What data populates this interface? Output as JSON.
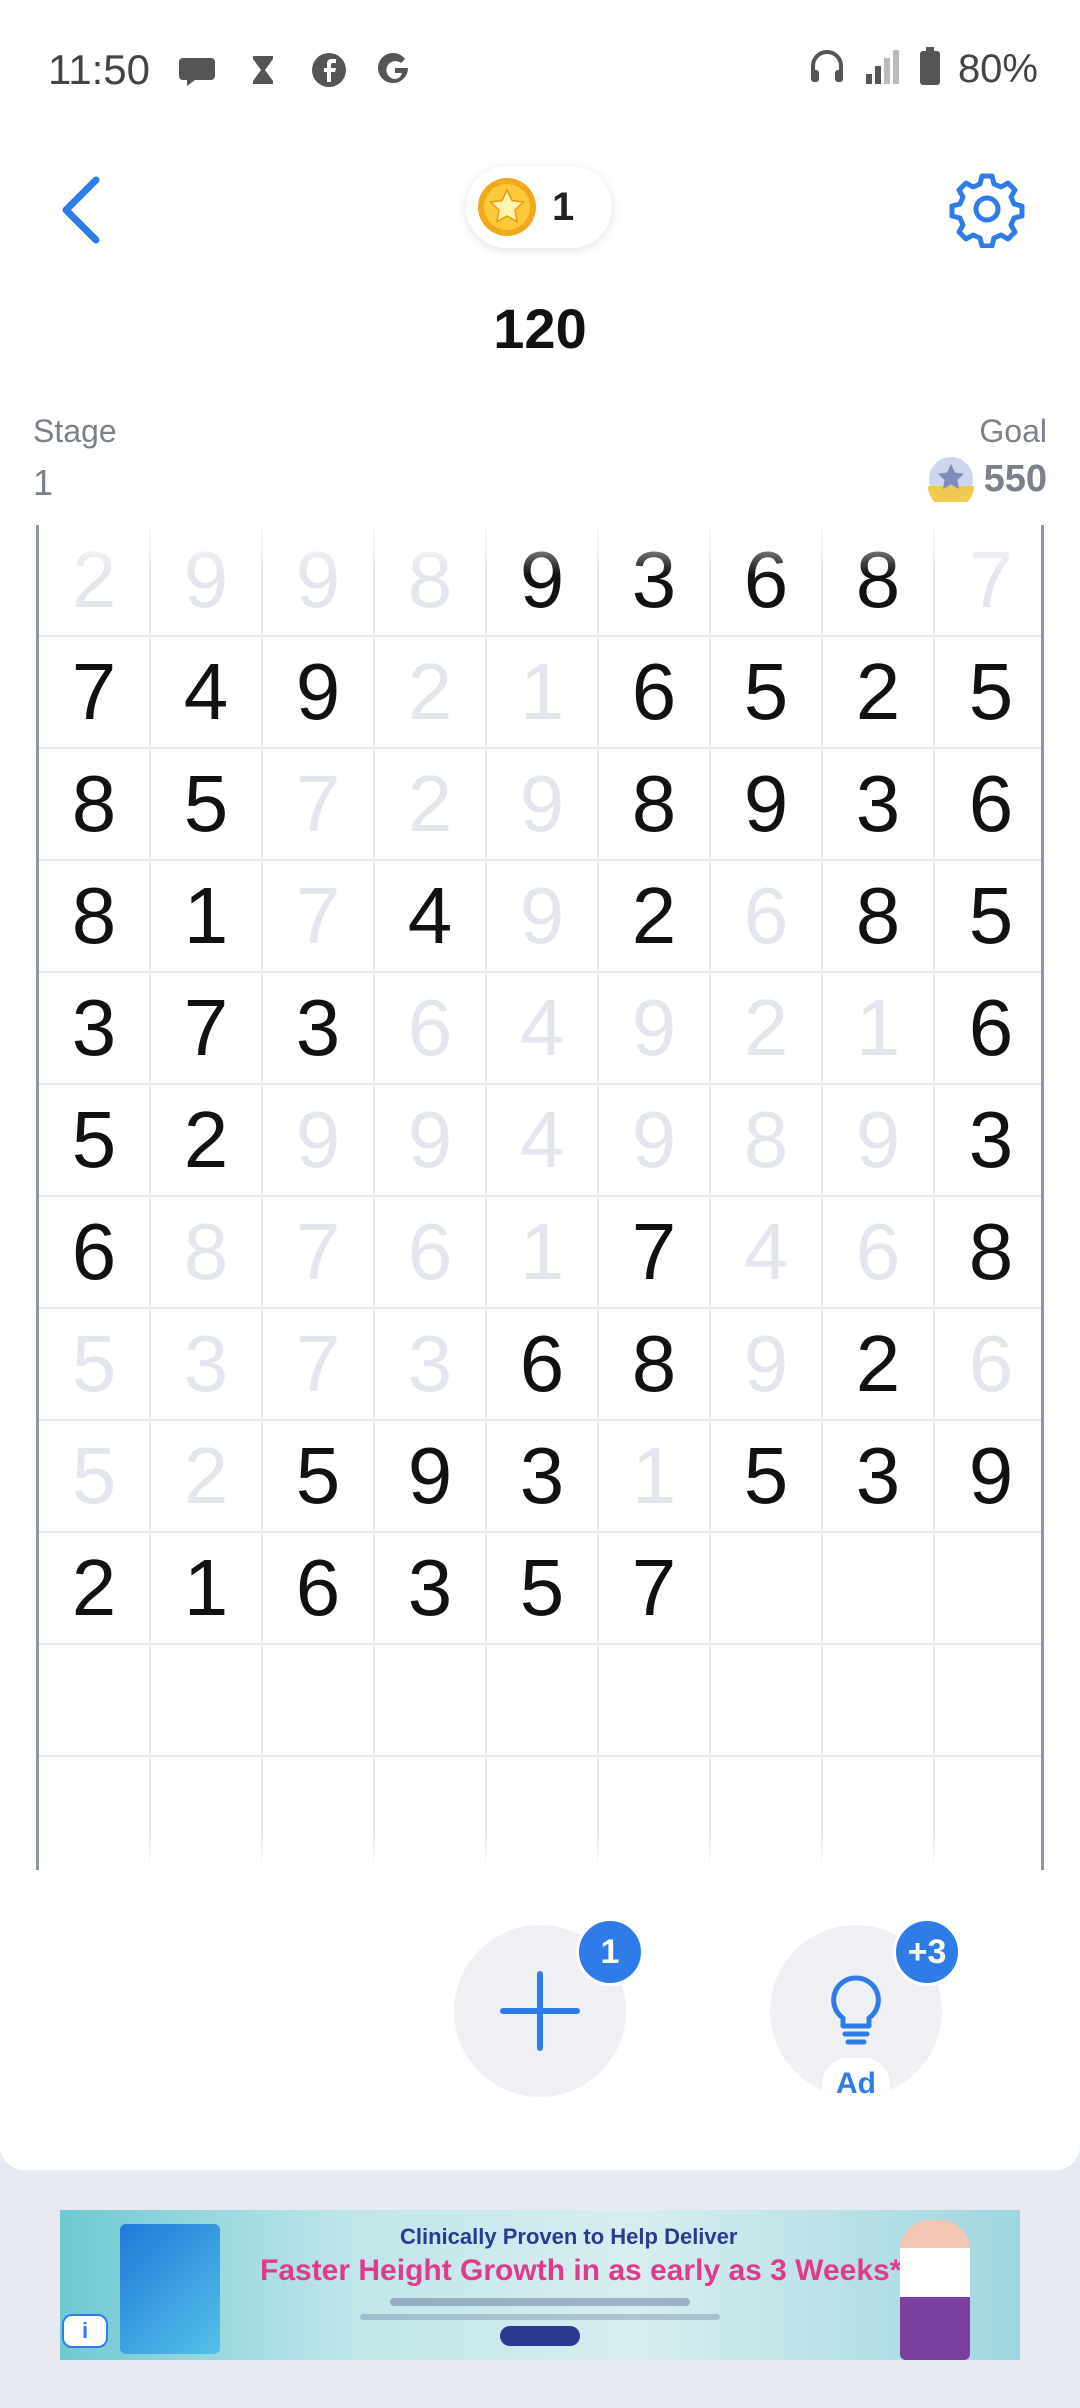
{
  "status_bar": {
    "time": "11:50",
    "left_icons": [
      "chat-icon",
      "hourglass-icon",
      "facebook-icon",
      "google-icon"
    ],
    "right_icons": [
      "headphones-icon",
      "signal-icon",
      "battery-icon"
    ],
    "battery": "80%"
  },
  "header": {
    "coins": "1",
    "score": "120",
    "stage_label": "Stage",
    "stage_value": "1",
    "goal_label": "Goal",
    "goal_value": "550"
  },
  "board": {
    "columns": 9,
    "rows": [
      [
        {
          "v": "2",
          "a": false
        },
        {
          "v": "9",
          "a": false
        },
        {
          "v": "9",
          "a": false
        },
        {
          "v": "8",
          "a": false
        },
        {
          "v": "9",
          "a": true
        },
        {
          "v": "3",
          "a": true
        },
        {
          "v": "6",
          "a": true
        },
        {
          "v": "8",
          "a": true
        },
        {
          "v": "7",
          "a": false
        }
      ],
      [
        {
          "v": "7",
          "a": true
        },
        {
          "v": "4",
          "a": true
        },
        {
          "v": "9",
          "a": true
        },
        {
          "v": "2",
          "a": false
        },
        {
          "v": "1",
          "a": false
        },
        {
          "v": "6",
          "a": true
        },
        {
          "v": "5",
          "a": true
        },
        {
          "v": "2",
          "a": true
        },
        {
          "v": "5",
          "a": true
        }
      ],
      [
        {
          "v": "8",
          "a": true
        },
        {
          "v": "5",
          "a": true
        },
        {
          "v": "7",
          "a": false
        },
        {
          "v": "2",
          "a": false
        },
        {
          "v": "9",
          "a": false
        },
        {
          "v": "8",
          "a": true
        },
        {
          "v": "9",
          "a": true
        },
        {
          "v": "3",
          "a": true
        },
        {
          "v": "6",
          "a": true
        }
      ],
      [
        {
          "v": "8",
          "a": true
        },
        {
          "v": "1",
          "a": true
        },
        {
          "v": "7",
          "a": false
        },
        {
          "v": "4",
          "a": true
        },
        {
          "v": "9",
          "a": false
        },
        {
          "v": "2",
          "a": true
        },
        {
          "v": "6",
          "a": false
        },
        {
          "v": "8",
          "a": true
        },
        {
          "v": "5",
          "a": true
        }
      ],
      [
        {
          "v": "3",
          "a": true
        },
        {
          "v": "7",
          "a": true
        },
        {
          "v": "3",
          "a": true
        },
        {
          "v": "6",
          "a": false
        },
        {
          "v": "4",
          "a": false
        },
        {
          "v": "9",
          "a": false
        },
        {
          "v": "2",
          "a": false
        },
        {
          "v": "1",
          "a": false
        },
        {
          "v": "6",
          "a": true
        }
      ],
      [
        {
          "v": "5",
          "a": true
        },
        {
          "v": "2",
          "a": true
        },
        {
          "v": "9",
          "a": false
        },
        {
          "v": "9",
          "a": false
        },
        {
          "v": "4",
          "a": false
        },
        {
          "v": "9",
          "a": false
        },
        {
          "v": "8",
          "a": false
        },
        {
          "v": "9",
          "a": false
        },
        {
          "v": "3",
          "a": true
        }
      ],
      [
        {
          "v": "6",
          "a": true
        },
        {
          "v": "8",
          "a": false
        },
        {
          "v": "7",
          "a": false
        },
        {
          "v": "6",
          "a": false
        },
        {
          "v": "1",
          "a": false
        },
        {
          "v": "7",
          "a": true
        },
        {
          "v": "4",
          "a": false
        },
        {
          "v": "6",
          "a": false
        },
        {
          "v": "8",
          "a": true
        }
      ],
      [
        {
          "v": "5",
          "a": false
        },
        {
          "v": "3",
          "a": false
        },
        {
          "v": "7",
          "a": false
        },
        {
          "v": "3",
          "a": false
        },
        {
          "v": "6",
          "a": true
        },
        {
          "v": "8",
          "a": true
        },
        {
          "v": "9",
          "a": false
        },
        {
          "v": "2",
          "a": true
        },
        {
          "v": "6",
          "a": false
        }
      ],
      [
        {
          "v": "5",
          "a": false
        },
        {
          "v": "2",
          "a": false
        },
        {
          "v": "5",
          "a": true
        },
        {
          "v": "9",
          "a": true
        },
        {
          "v": "3",
          "a": true
        },
        {
          "v": "1",
          "a": false
        },
        {
          "v": "5",
          "a": true
        },
        {
          "v": "3",
          "a": true
        },
        {
          "v": "9",
          "a": true
        }
      ],
      [
        {
          "v": "2",
          "a": true
        },
        {
          "v": "1",
          "a": true
        },
        {
          "v": "6",
          "a": true
        },
        {
          "v": "3",
          "a": true
        },
        {
          "v": "5",
          "a": true
        },
        {
          "v": "7",
          "a": true
        },
        {
          "v": "",
          "a": true
        },
        {
          "v": "",
          "a": true
        },
        {
          "v": "",
          "a": true
        }
      ],
      [
        {
          "v": "",
          "a": true
        },
        {
          "v": "",
          "a": true
        },
        {
          "v": "",
          "a": true
        },
        {
          "v": "",
          "a": true
        },
        {
          "v": "",
          "a": true
        },
        {
          "v": "",
          "a": true
        },
        {
          "v": "",
          "a": true
        },
        {
          "v": "",
          "a": true
        },
        {
          "v": "",
          "a": true
        }
      ],
      [
        {
          "v": "",
          "a": true
        },
        {
          "v": "",
          "a": true
        },
        {
          "v": "",
          "a": true
        },
        {
          "v": "",
          "a": true
        },
        {
          "v": "",
          "a": true
        },
        {
          "v": "",
          "a": true
        },
        {
          "v": "",
          "a": true
        },
        {
          "v": "",
          "a": true
        },
        {
          "v": "",
          "a": true
        }
      ]
    ]
  },
  "actions": {
    "add_badge": "1",
    "hint_badge": "+3",
    "hint_ad_label": "Ad"
  },
  "banner": {
    "line1": "Clinically Proven to Help Deliver",
    "line2": "Faster Height Growth in as early as 3 Weeks*",
    "info": "i"
  },
  "colors": {
    "accent": "#2f7be8",
    "active_digit": "#111111",
    "faded_digit": "#e3e6ec",
    "muted_text": "#7b808a"
  }
}
